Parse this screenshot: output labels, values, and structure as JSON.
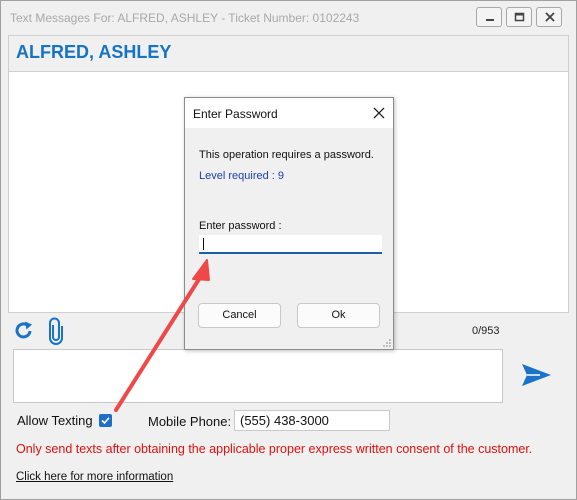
{
  "window": {
    "title": "Text Messages For: ALFRED, ASHLEY - Ticket Number: 0102243"
  },
  "header": {
    "customer_name": "ALFRED, ASHLEY"
  },
  "toolbar": {
    "char_count": "0/953",
    "refresh_icon": "refresh-icon",
    "attach_icon": "paperclip-icon",
    "send_icon": "send-arrow-icon"
  },
  "compose": {
    "value": ""
  },
  "options": {
    "allow_texting_label": "Allow Texting",
    "allow_texting_checked": true,
    "mobile_phone_label": "Mobile Phone:",
    "mobile_phone_value": "(555) 438-3000"
  },
  "footer": {
    "warning": "Only send texts after obtaining the applicable proper express written consent of the customer.",
    "info_link": "Click here for more information"
  },
  "dialog": {
    "title": "Enter Password",
    "message": "This operation requires a password.",
    "level_required": "Level required : 9",
    "password_label": "Enter password :",
    "password_value": "",
    "cancel_label": "Cancel",
    "ok_label": "Ok"
  },
  "colors": {
    "accent_blue": "#1574c4",
    "warning_red": "#e01010",
    "annotation_arrow": "#f04848"
  }
}
